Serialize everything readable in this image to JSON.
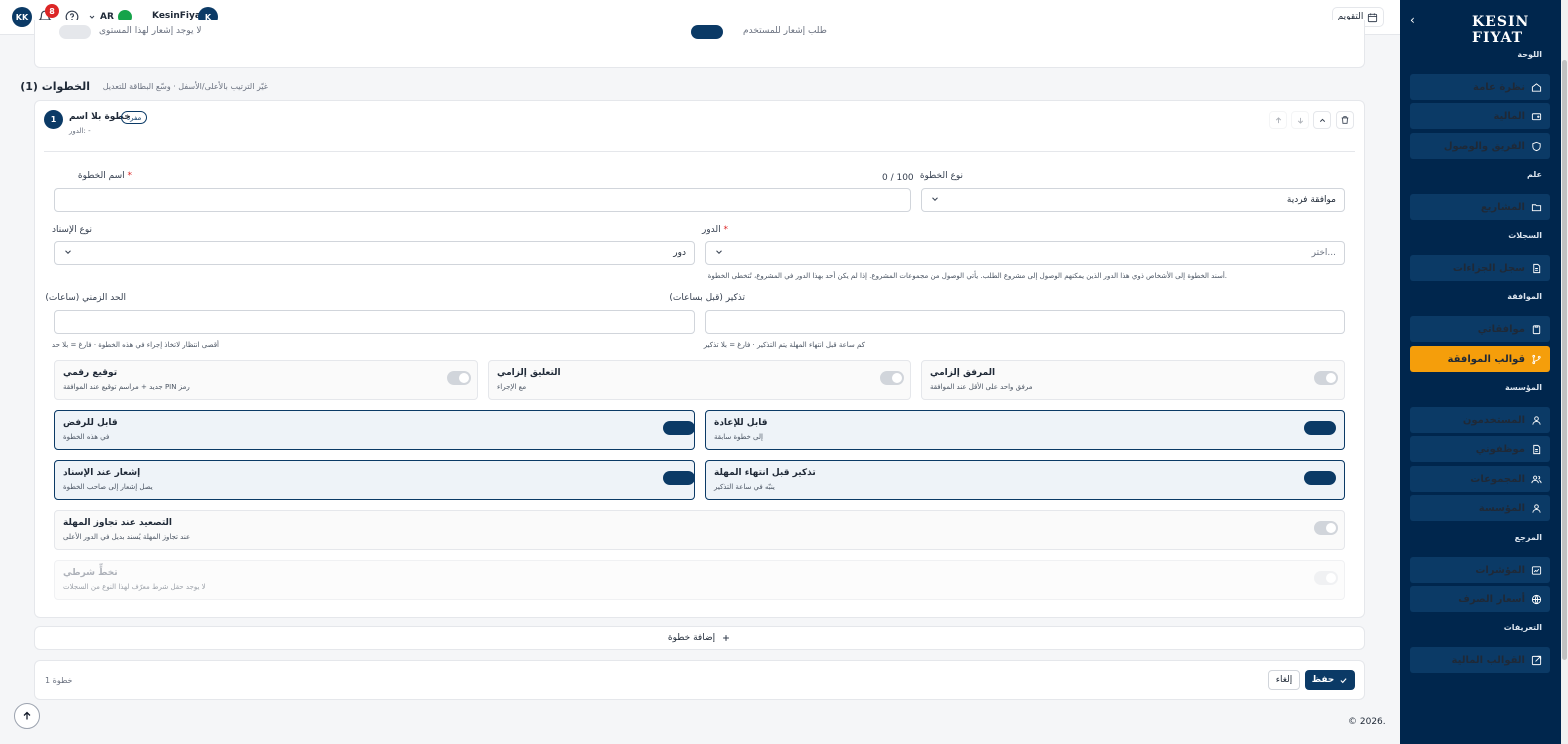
{
  "topbar": {
    "avatar_initials": "KK",
    "notification_count": "8",
    "language": "AR",
    "user_name": "KesinFiyat",
    "user_initial": "K",
    "calendar_label": "التقويم"
  },
  "sidebar": {
    "brand": "KESIN FIYAT",
    "sections": [
      {
        "label": "اللوحة",
        "items": [
          "نظرة عامة",
          "المالية",
          "الفريق والوصول"
        ]
      },
      {
        "label": "علم",
        "items": [
          "المشاريع"
        ]
      },
      {
        "label": "السجلات",
        "items": [
          "سجل الجزاءات"
        ]
      },
      {
        "label": "الموافقة",
        "items": [
          "موافقاتي",
          "قوالب الموافقة"
        ]
      },
      {
        "label": "المؤسسة",
        "items": [
          "المستخدمون",
          "موظفوني",
          "المجموعات",
          "المؤسسة"
        ]
      },
      {
        "label": "المرجع",
        "items": [
          "المؤشرات",
          "أسعار الصرف"
        ]
      },
      {
        "label": "التعريفات",
        "items": [
          "القوالب المالية"
        ]
      }
    ],
    "active_item": "قوالب الموافقة",
    "accent": "#f59e0b"
  },
  "top_partial": {
    "left_text": "لا يوجد إشعار لهذا المستوى",
    "right_text": "طلب إشعار للمستخدم"
  },
  "steps": {
    "title": "الخطوات (1)",
    "hint": "غيّر الترتيب بالأعلى/الأسفل · وسّع البطاقة للتعديل"
  },
  "step": {
    "number": "1",
    "name": "خطوة بلا اسم",
    "badge": "مفرد",
    "role_line": "الدور: -",
    "fields": {
      "step_type": {
        "label": "نوع الخطوة",
        "value": "موافقة فردية"
      },
      "step_name": {
        "label": "اسم الخطوة",
        "counter": "0 / 100",
        "value": ""
      },
      "role": {
        "label": "الدور",
        "placeholder": "اختر...",
        "hint": "أسند الخطوة إلى الأشخاص ذوي هذا الدور الذين يمكنهم الوصول إلى مشروع الطلب. يأتي الوصول من مجموعات المشروع. إذا لم يكن أحد بهذا الدور في المشروع، تُتخطى الخطوة."
      },
      "assignment_type": {
        "label": "نوع الإسناد",
        "value": "دور"
      },
      "reminder": {
        "label": "تذكير (قبل بساعات)",
        "hint": "كم ساعة قبل انتهاء المهلة يتم التذكير · فارغ = بلا تذكير"
      },
      "time_limit": {
        "label": "الحد الزمني (ساعات)",
        "hint": "أقصى انتظار لاتخاذ إجراء في هذه الخطوة · فارغ = بلا حد"
      }
    },
    "options": {
      "attachment": {
        "title": "المرفق إلزامي",
        "desc": "مرفق واحد على الأقل عند الموافقة",
        "on": false
      },
      "comment": {
        "title": "التعليق إلزامي",
        "desc": "مع الإجراء",
        "on": false
      },
      "signature": {
        "title": "توقيع رقمي",
        "desc": "جديد + مراسم توقيع عند الموافقة PIN رمز",
        "on": false
      },
      "returnable": {
        "title": "قابل للإعادة",
        "desc": "إلى خطوة سابقة",
        "on": true
      },
      "rejectable": {
        "title": "قابل للرفض",
        "desc": "في هذه الخطوة",
        "on": true
      },
      "deadline_reminder": {
        "title": "تذكير قبل انتهاء المهلة",
        "desc": "ينبّه في ساعة التذكير",
        "on": true
      },
      "assign_notify": {
        "title": "إشعار عند الإسناد",
        "desc": "يصل إشعار إلى صاحب الخطوة",
        "on": true
      },
      "escalation": {
        "title": "التصعيد عند تجاوز المهلة",
        "desc": "عند تجاوز المهلة يُسند بديل في الدور الأعلى",
        "on": false
      },
      "conditional_skip": {
        "title": "تخطٍّ شرطي",
        "desc": "لا يوجد حقل شرط معرّف لهذا النوع من السجلات",
        "on": false
      }
    }
  },
  "add_step_label": "إضافة خطوة",
  "footer": {
    "save": "حفظ",
    "cancel": "إلغاء",
    "step_count": "خطوة 1"
  },
  "copyright": "© 2026."
}
